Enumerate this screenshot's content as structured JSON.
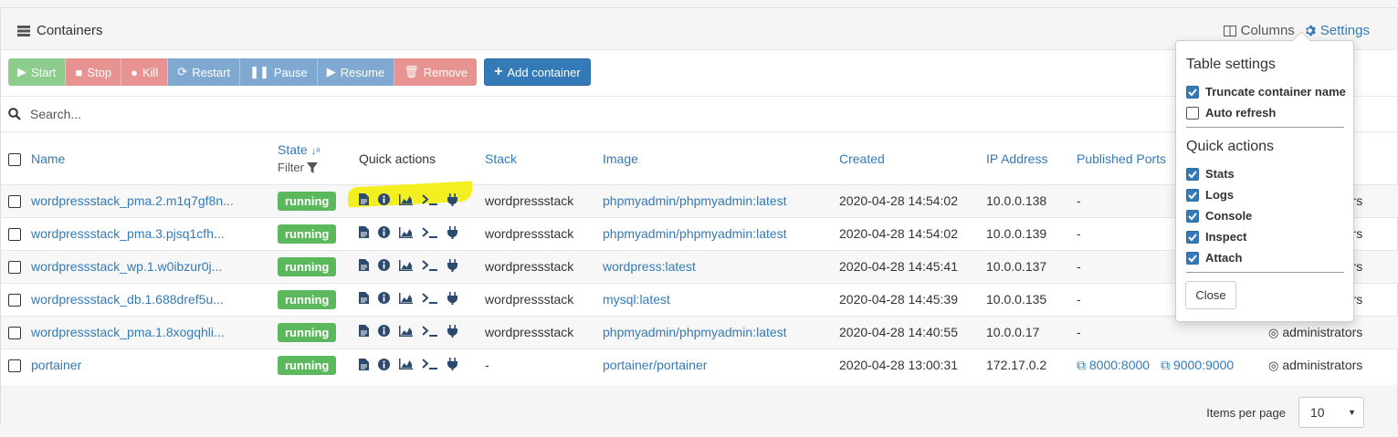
{
  "panel": {
    "title": "Containers",
    "columns_label": "Columns",
    "settings_label": "Settings"
  },
  "toolbar": {
    "start": "Start",
    "stop": "Stop",
    "kill": "Kill",
    "restart": "Restart",
    "pause": "Pause",
    "resume": "Resume",
    "remove": "Remove",
    "add": "Add container"
  },
  "search": {
    "placeholder": "Search..."
  },
  "columns": {
    "name": "Name",
    "state": "State",
    "filter": "Filter",
    "quick_actions": "Quick actions",
    "stack": "Stack",
    "image": "Image",
    "created": "Created",
    "ip": "IP Address",
    "ports": "Published Ports"
  },
  "rows": [
    {
      "name": "wordpressstack_pma.2.m1q7gf8n...",
      "state": "running",
      "stack": "wordpressstack",
      "image": "phpmyadmin/phpmyadmin:latest",
      "created": "2020-04-28 14:54:02",
      "ip": "10.0.0.138",
      "ports": "-",
      "ownership": "administrators"
    },
    {
      "name": "wordpressstack_pma.3.pjsq1cfh...",
      "state": "running",
      "stack": "wordpressstack",
      "image": "phpmyadmin/phpmyadmin:latest",
      "created": "2020-04-28 14:54:02",
      "ip": "10.0.0.139",
      "ports": "-",
      "ownership": "administrators"
    },
    {
      "name": "wordpressstack_wp.1.w0ibzur0j...",
      "state": "running",
      "stack": "wordpressstack",
      "image": "wordpress:latest",
      "created": "2020-04-28 14:45:41",
      "ip": "10.0.0.137",
      "ports": "-",
      "ownership": "administrators"
    },
    {
      "name": "wordpressstack_db.1.688dref5u...",
      "state": "running",
      "stack": "wordpressstack",
      "image": "mysql:latest",
      "created": "2020-04-28 14:45:39",
      "ip": "10.0.0.135",
      "ports": "-",
      "ownership": "administrators"
    },
    {
      "name": "wordpressstack_pma.1.8xogqhli...",
      "state": "running",
      "stack": "wordpressstack",
      "image": "phpmyadmin/phpmyadmin:latest",
      "created": "2020-04-28 14:40:55",
      "ip": "10.0.0.17",
      "ports": "-",
      "ownership": "administrators"
    },
    {
      "name": "portainer",
      "state": "running",
      "stack": "-",
      "image": "portainer/portainer",
      "created": "2020-04-28 13:00:31",
      "ip": "172.17.0.2",
      "port1": "8000:8000",
      "port2": "9000:9000",
      "ownership": "administrators"
    }
  ],
  "footer": {
    "items_per_page_label": "Items per page",
    "items_per_page_value": "10"
  },
  "settings_popover": {
    "title": "Table settings",
    "truncate": "Truncate container name",
    "auto_refresh": "Auto refresh",
    "quick_actions_title": "Quick actions",
    "stats": "Stats",
    "logs": "Logs",
    "console": "Console",
    "inspect": "Inspect",
    "attach": "Attach",
    "close": "Close"
  },
  "icons": {
    "panel": "list-icon",
    "columns": "columns-icon",
    "settings": "gear-icon",
    "quick_actions": [
      "file-icon",
      "info-icon",
      "chart-icon",
      "terminal-icon",
      "plug-icon"
    ]
  },
  "colors": {
    "accent": "#337ab7",
    "running": "#5cb85c",
    "highlight": "#f4ef20"
  }
}
